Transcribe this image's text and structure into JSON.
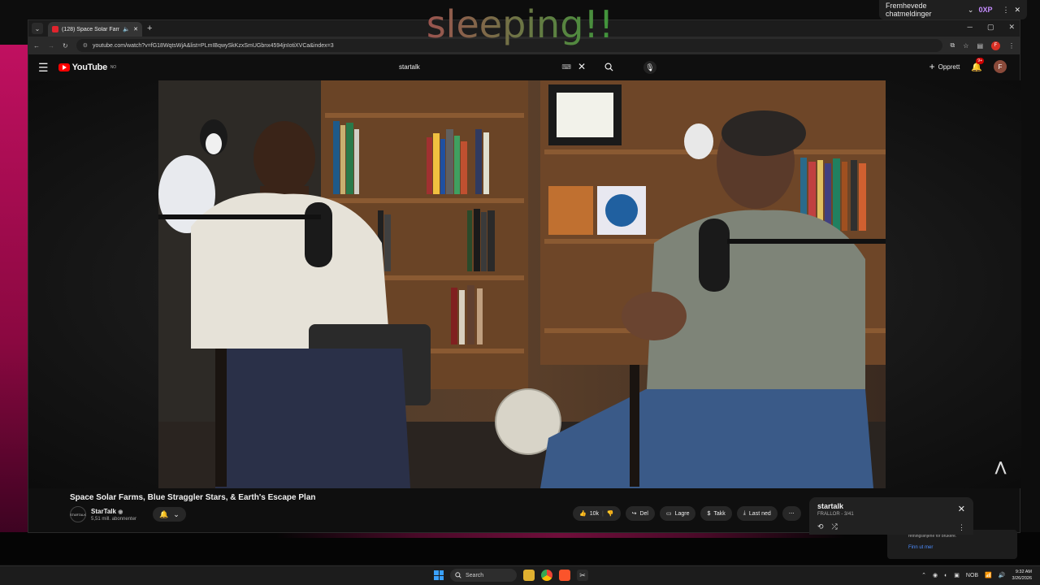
{
  "overlay": {
    "text": "sleeping!!"
  },
  "top_right_pill": {
    "label": "Fremhevede chatmeldinger",
    "xp": "0XP"
  },
  "browser": {
    "tab_title": "(128) Space Solar Farms, Bl...",
    "url": "youtube.com/watch?v=fG18WqtsWjA&list=PLmIBqwySkKzxSmUGbnx4594jnIotiXVCa&index=3"
  },
  "youtube": {
    "logo_text": "YouTube",
    "logo_country": "NO",
    "search_query": "startalk",
    "create_label": "Opprett",
    "notif_count": "9+",
    "avatar_letter": "F"
  },
  "video": {
    "title": "Space Solar Farms, Blue Straggler Stars, & Earth's Escape Plan",
    "channel_name": "StarTalk",
    "channel_subs": "5,51 mill. abonnenter",
    "channel_avatar_text": "STARTALK",
    "likes": "10k",
    "share_label": "Del",
    "save_label": "Lagre",
    "thanks_label": "Takk",
    "download_label": "Last ned"
  },
  "playlist": {
    "title": "startalk",
    "subtitle": "FRALLOR - 3/41"
  },
  "notification": {
    "text": "retningslinjene for brukere.",
    "link": "Finn ut mer"
  },
  "taskbar": {
    "search": "Search",
    "lang": "NOB",
    "time": "9:32 AM",
    "date": "3/26/2026"
  },
  "icons": [
    "menu-icon",
    "search-icon",
    "mic-icon",
    "bell-icon",
    "like-icon",
    "dislike-icon",
    "share-icon",
    "save-icon",
    "thanks-icon",
    "download-icon",
    "more-icon",
    "close-icon",
    "loop-icon",
    "shuffle-icon",
    "windows-icon",
    "chrome-icon",
    "brave-icon",
    "folder-icon"
  ]
}
